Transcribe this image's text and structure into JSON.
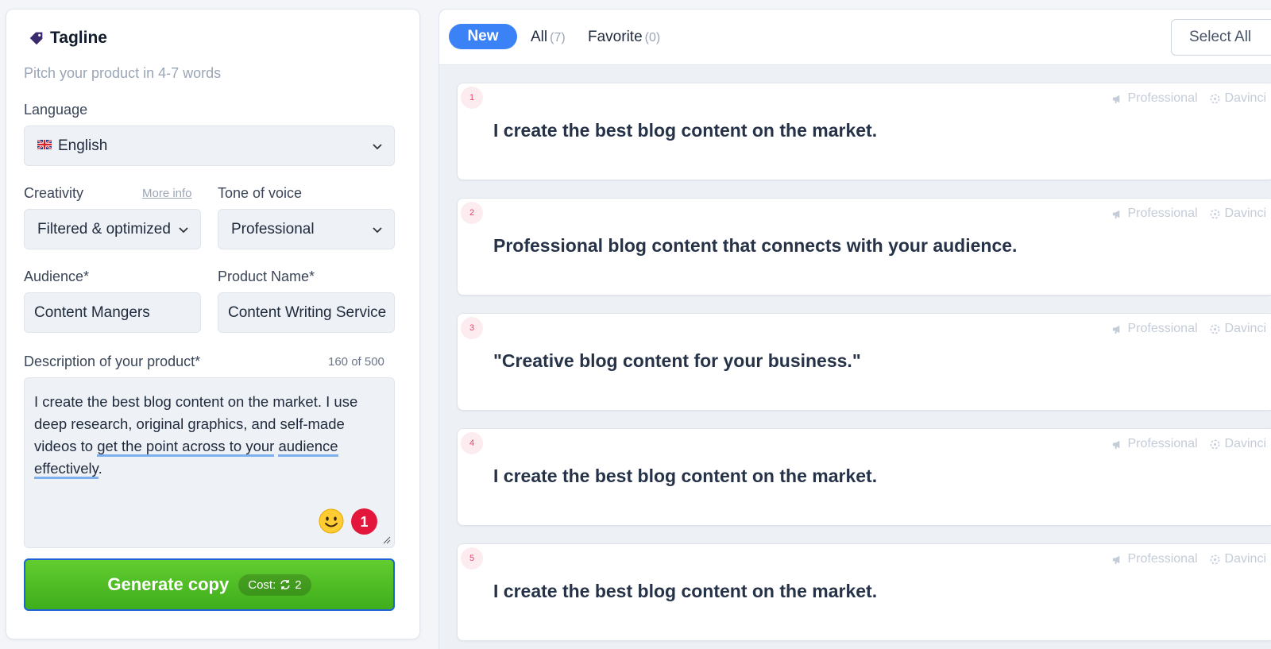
{
  "form": {
    "title": "Tagline",
    "subtitle": "Pitch your product in 4-7 words",
    "language": {
      "label": "Language",
      "value": "English"
    },
    "creativity": {
      "label": "Creativity",
      "more_info": "More info",
      "value": "Filtered & optimized"
    },
    "tone": {
      "label": "Tone of voice",
      "value": "Professional"
    },
    "audience": {
      "label": "Audience*",
      "value": "Content Mangers"
    },
    "product_name": {
      "label": "Product Name*",
      "value": "Content Writing Service"
    },
    "description": {
      "label": "Description of your product*",
      "counter": "160 of 500",
      "text_before": "I create the best blog content on the market. I use deep research, original graphics, and self-made videos to ",
      "text_underlined_1": "get the point across to your",
      "text_underlined_2": "audience effectively",
      "text_after": ".",
      "issue_count": "1"
    },
    "generate": {
      "label": "Generate copy",
      "cost_label": "Cost:",
      "cost_value": "2"
    }
  },
  "results_header": {
    "tab_new": "New",
    "tab_all": "All",
    "tab_all_count": "(7)",
    "tab_favorite": "Favorite",
    "tab_favorite_count": "(0)",
    "select_all": "Select All"
  },
  "results": [
    {
      "num": "1",
      "text": "I create the best blog content on the market.",
      "tone": "Professional",
      "model": "Davinci"
    },
    {
      "num": "2",
      "text": "Professional blog content that connects with your audience.",
      "tone": "Professional",
      "model": "Davinci"
    },
    {
      "num": "3",
      "text": "\"Creative blog content for your business.\"",
      "tone": "Professional",
      "model": "Davinci"
    },
    {
      "num": "4",
      "text": "I create the best blog content on the market.",
      "tone": "Professional",
      "model": "Davinci"
    },
    {
      "num": "5",
      "text": "I create the best blog content on the market.",
      "tone": "Professional",
      "model": "Davinci"
    }
  ],
  "colors": {
    "accent": "#3b82f6",
    "generate": "#4cb824",
    "badge": "#e3163b"
  },
  "icons": [
    "tag-icon",
    "flag-uk-icon",
    "chevron-down-icon",
    "emoji-icon",
    "refresh-icon",
    "megaphone-icon",
    "ai-model-icon"
  ]
}
